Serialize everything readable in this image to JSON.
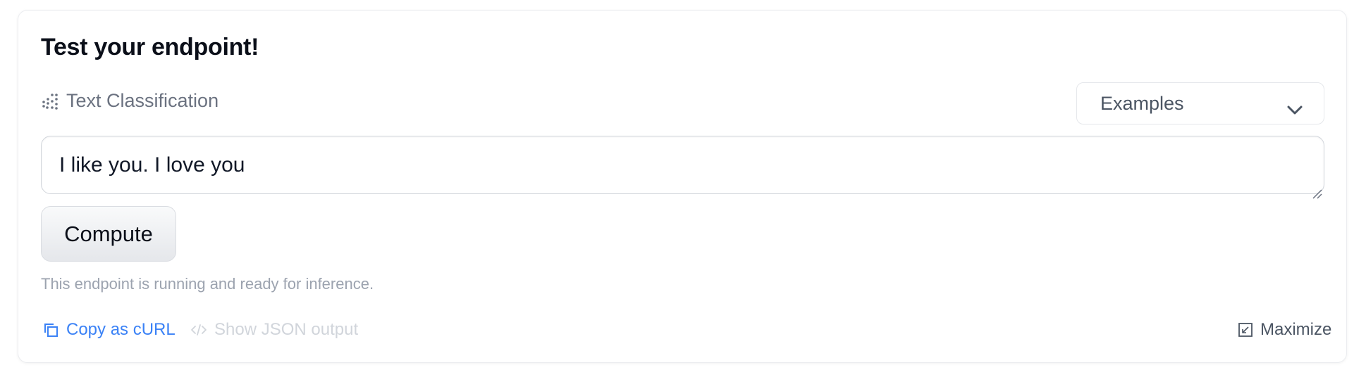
{
  "card": {
    "title": "Test your endpoint!"
  },
  "task": {
    "icon": "text-classification-icon",
    "label": "Text Classification"
  },
  "examples": {
    "label": "Examples",
    "icon": "chevron-down-icon"
  },
  "input": {
    "value": "I like you. I love you"
  },
  "compute": {
    "label": "Compute"
  },
  "status": {
    "text": "This endpoint is running and ready for inference."
  },
  "footer": {
    "copy_curl": "Copy as cURL",
    "show_json": "Show JSON output",
    "maximize": "Maximize"
  },
  "colors": {
    "link_blue": "#3b82f6",
    "muted_gray": "#9ca3af",
    "disabled_gray": "#d1d5db"
  }
}
